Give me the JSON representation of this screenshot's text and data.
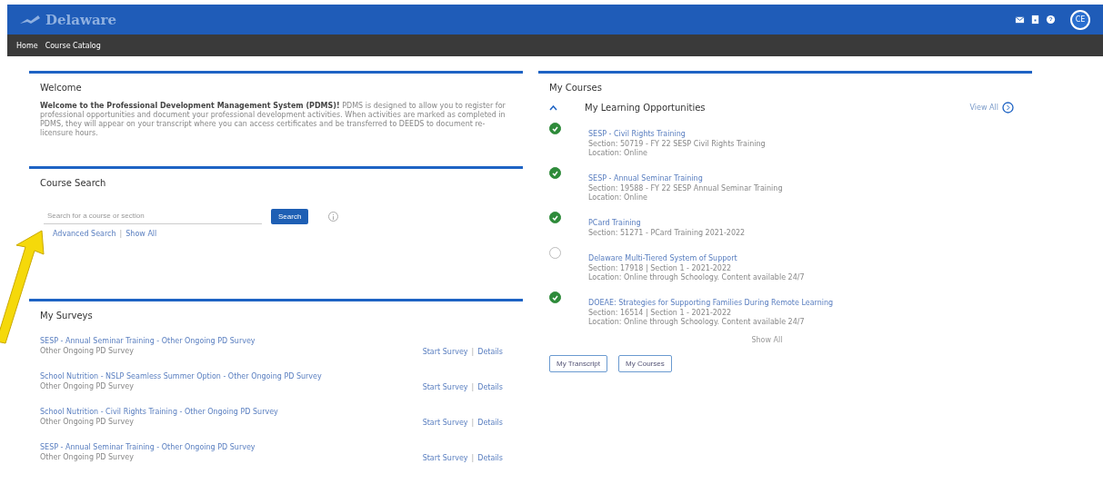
{
  "header": {
    "logo_text": "Delaware",
    "avatar": "CE"
  },
  "nav": [
    {
      "label": "Home"
    },
    {
      "label": "Course Catalog"
    }
  ],
  "welcome": {
    "title": "Welcome",
    "text": "**Welcome to the Professional Development Management System (PDMS)!** PDMS is designed to allow you to register for professional opportunities and document your professional development activities. When activities are marked as completed in PDMS, they will appear on your transcript where you can access certificates and be transferred to DEEDS to document re-licensure hours."
  },
  "course_search": {
    "title": "Course Search",
    "placeholder": "Search for a course or section",
    "button": "Search",
    "links": [
      "Advanced Search",
      "Show All"
    ],
    "separator": "|"
  },
  "surveys": {
    "title": "My Surveys",
    "items": [
      {
        "name": "SESP - Annual Seminar Training - Other Ongoing PD Survey",
        "type": "Other Ongoing PD Survey",
        "actions": [
          "Start Survey",
          "Details"
        ],
        "separator": "|"
      },
      {
        "name": "School Nutrition - NSLP Seamless Summer Option - Other Ongoing PD Survey",
        "type": "Other Ongoing PD Survey",
        "actions": [
          "Start Survey",
          "Details"
        ],
        "separator": "|"
      },
      {
        "name": "School Nutrition - Civil Rights Training - Other Ongoing PD Survey",
        "type": "Other Ongoing PD Survey",
        "actions": [
          "Start Survey",
          "Details"
        ],
        "separator": "|"
      },
      {
        "name": "SESP - Annual Seminar Training - Other Ongoing PD Survey",
        "type": "Other Ongoing PD Survey",
        "actions": [
          "Start Survey",
          "Details"
        ],
        "separator": "|"
      }
    ]
  },
  "my_courses": {
    "title": "My Courses",
    "section": "My Learning Opportunities",
    "expanded": true,
    "view_all": "View All",
    "show_all": "Show All",
    "items": [
      {
        "name": "SESP - Civil Rights Training",
        "lines": [
          "Section: 50719 - FY 22 SESP Civil Rights Training",
          "Location: Online"
        ],
        "completed": true
      },
      {
        "name": "SESP - Annual Seminar Training",
        "lines": [
          "Section: 19588 - FY 22 SESP Annual Seminar Training",
          "Location: Online"
        ],
        "completed": true
      },
      {
        "name": "PCard Training",
        "lines": [
          "Section: 51271 - PCard Training 2021-2022"
        ],
        "completed": true
      },
      {
        "name": "Delaware Multi-Tiered System of Support",
        "lines": [
          "Section: 17918 | Section 1 - 2021-2022",
          "Location: Online through Schoology. Content available 24/7"
        ],
        "completed": false
      },
      {
        "name": "DOEAE: Strategies for Supporting Families During Remote Learning",
        "lines": [
          "Section: 16514 | Section 1 - 2021-2022",
          "Location: Online through Schoology. Content available 24/7"
        ],
        "completed": true
      }
    ],
    "buttons": [
      "My Transcript",
      "My Courses"
    ]
  }
}
